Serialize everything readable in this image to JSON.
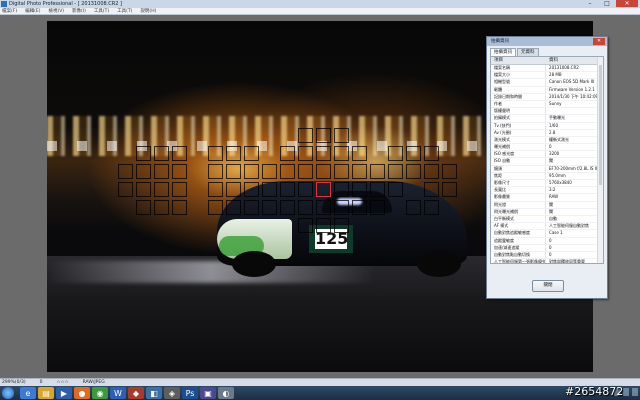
{
  "window": {
    "title": "Digital Photo Professional - [ 20131008.CR2 ]",
    "buttons": {
      "minimize": "–",
      "maximize": "□",
      "close": "✕"
    }
  },
  "menubar": {
    "items": [
      "檔案(F)",
      "編輯(E)",
      "檢視(V)",
      "影像(I)",
      "工具(T)",
      "工具(T)",
      "說明(H)"
    ]
  },
  "dialog": {
    "title": "拍攝資訊",
    "tabs": [
      "拍攝資訊",
      "元資料"
    ],
    "headers": {
      "item": "項目",
      "value": "資料"
    },
    "rows": [
      [
        "檔案名稱",
        "20131008.CR2"
      ],
      [
        "檔案大小",
        "28 MB"
      ],
      [
        "相機型號",
        "Canon EOS 5D Mark III"
      ],
      [
        "韌體",
        "Firmware Version 1.2.1"
      ],
      [
        "記錄日期和時間",
        "2014/1/30 下午 10:42:09"
      ],
      [
        "作者",
        "Sunny"
      ],
      [
        "版權聲明",
        ""
      ],
      [
        "拍攝模式",
        "手動曝光"
      ],
      [
        "Tv (快門)",
        "1/60"
      ],
      [
        "Av (光圈)",
        "2.8"
      ],
      [
        "測光模式",
        "權衡式測光"
      ],
      [
        "曝光補償",
        "0"
      ],
      [
        "ISO 感光度",
        "3200"
      ],
      [
        "ISO 自動",
        "關"
      ],
      [
        "鏡頭",
        "EF70-200mm f/2.8L IS II USM"
      ],
      [
        "焦距",
        "95.0mm"
      ],
      [
        "影像尺寸",
        "5760x3840"
      ],
      [
        "長寬比",
        "3:2"
      ],
      [
        "影像畫質",
        "RAW"
      ],
      [
        "閃光燈",
        "關"
      ],
      [
        "閃光曝光補償",
        "關"
      ],
      [
        "白平衡模式",
        "自動"
      ],
      [
        "AF 模式",
        "人工智能伺服自動對焦"
      ],
      [
        "自動對焦追蹤敏感度",
        "Case 1"
      ],
      [
        "追蹤靈敏度",
        "0"
      ],
      [
        "加速/減速追蹤",
        "0"
      ],
      [
        "自動對焦點自動切換",
        "0"
      ],
      [
        "人工智能伺服第一張影像優先",
        "對焦與釋放同等重要"
      ],
      [
        "銳利度",
        "3"
      ],
      [
        "對比",
        "0"
      ],
      [
        "飽和度",
        "0"
      ],
      [
        "色調",
        "0"
      ]
    ],
    "ok_label": "關閉"
  },
  "photo": {
    "car_number": "125"
  },
  "statusbar": {
    "zoom": "299%(0/3)",
    "mark": "0",
    "stars": "☆☆☆",
    "format": "RAW/JPEG"
  },
  "taskbar": {
    "icons": [
      "ie-icon",
      "folder-icon",
      "media-icon",
      "firefox-icon",
      "chrome-icon",
      "office-icon",
      "app-icon",
      "app2-icon",
      "dpp-icon",
      "photoshop-icon",
      "app3-icon",
      "app4-icon"
    ]
  },
  "watermark": "#2654872",
  "colors": {
    "af_selected": "#d63b3b",
    "taskbar": "#1b2e44"
  }
}
